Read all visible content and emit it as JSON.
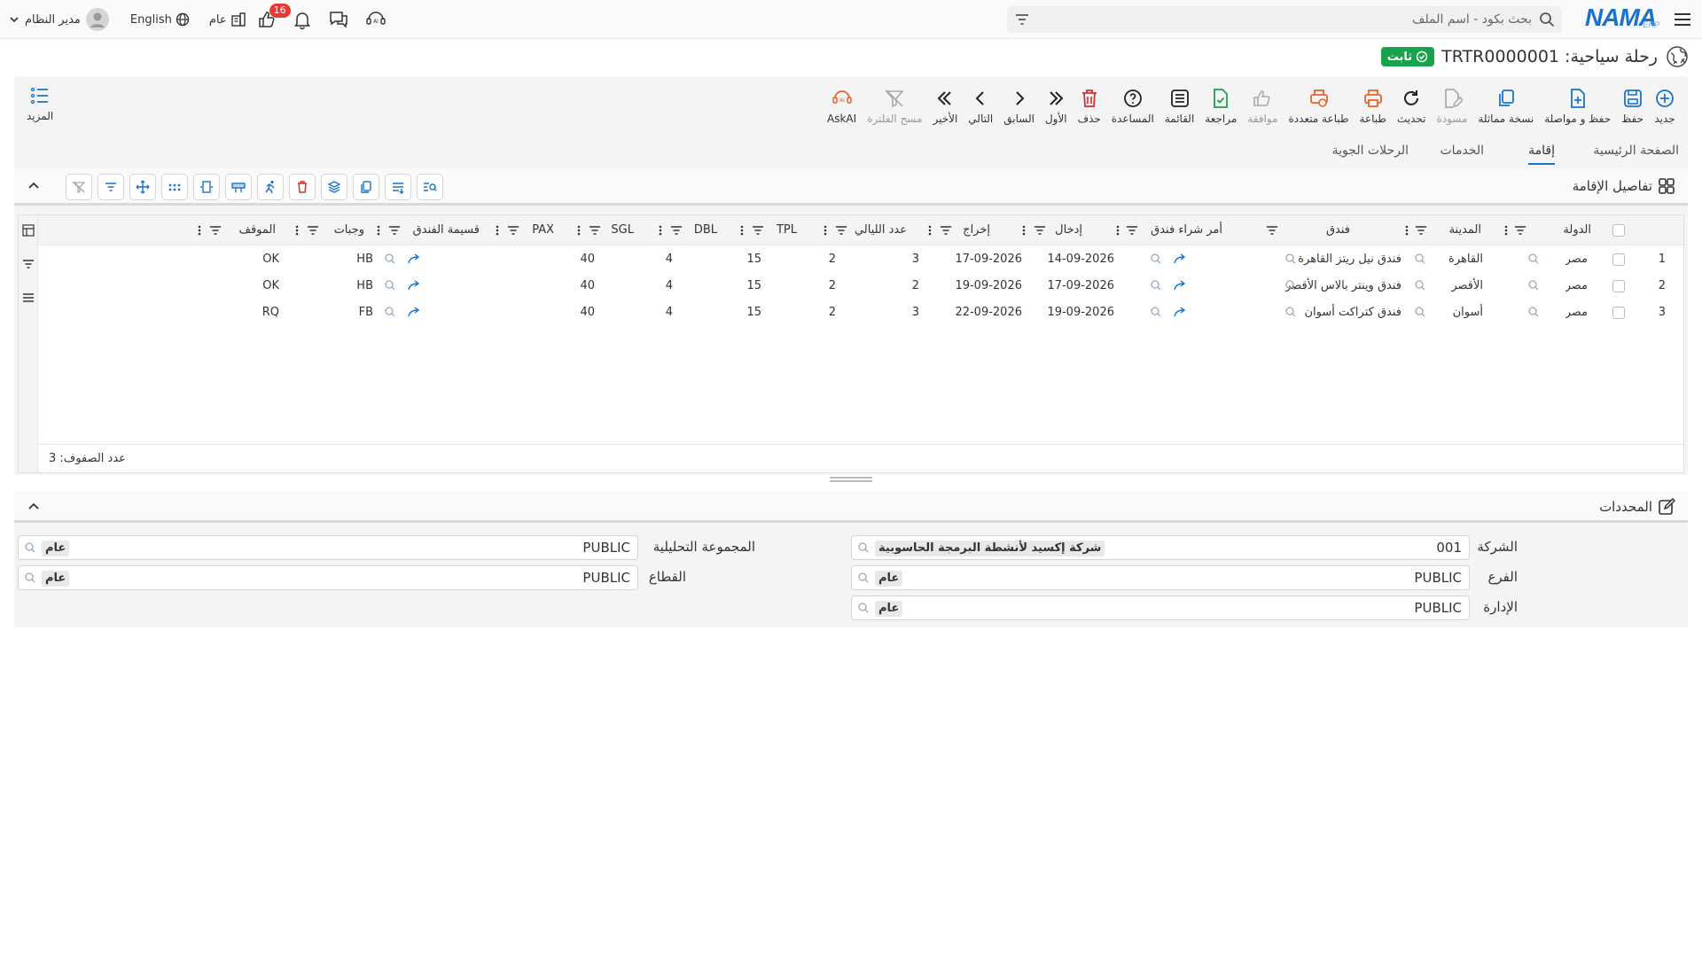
{
  "app": {
    "logo_text": "NAMA",
    "logo_sub": "ERP",
    "search_placeholder": "بحث بكود - اسم الملف",
    "user_name": "مدير النظام",
    "language": "English",
    "scope": "عام",
    "notifications_count": "16"
  },
  "page": {
    "title": "رحلة سياحية: TRTR0000001",
    "status": "ثابت"
  },
  "toolbar": {
    "items": [
      {
        "label": "جديد",
        "icon": "plus-circle-icon",
        "color": "#1a73c9"
      },
      {
        "label": "حفظ",
        "icon": "save-icon",
        "color": "#1a73c9"
      },
      {
        "label": "حفظ و مواصلة",
        "icon": "file-plus-icon",
        "color": "#1a73c9"
      },
      {
        "label": "نسخة مماثلة",
        "icon": "copy-icon",
        "color": "#1a73c9"
      },
      {
        "label": "مسودة",
        "icon": "edit-file-icon",
        "color": "#999999"
      },
      {
        "label": "تحديث",
        "icon": "refresh-icon",
        "color": "#222222"
      },
      {
        "label": "طباعة",
        "icon": "print-icon",
        "color": "#e8622c"
      },
      {
        "label": "طباعة متعددة",
        "icon": "print-multi-icon",
        "color": "#e8622c"
      },
      {
        "label": "موافقة",
        "icon": "thumbs-up-icon",
        "color": "#999999"
      },
      {
        "label": "مراجعة",
        "icon": "file-check-icon",
        "color": "#17a34a"
      },
      {
        "label": "القائمة",
        "icon": "list-icon",
        "color": "#222222"
      },
      {
        "label": "المساعدة",
        "icon": "help-icon",
        "color": "#222222"
      },
      {
        "label": "حذف",
        "icon": "trash-icon",
        "color": "#d32f2f"
      },
      {
        "label": "الأول",
        "icon": "first-icon",
        "color": "#222222"
      },
      {
        "label": "السابق",
        "icon": "prev-icon",
        "color": "#222222"
      },
      {
        "label": "التالي",
        "icon": "next-icon",
        "color": "#222222"
      },
      {
        "label": "الأخير",
        "icon": "last-icon",
        "color": "#222222"
      },
      {
        "label": "مسح الفلترة",
        "icon": "clear-filter-icon",
        "color": "#999999"
      },
      {
        "label": "AskAI",
        "icon": "ai-icon",
        "color": "#e8622c"
      }
    ],
    "more_label": "المزيد"
  },
  "tabs": [
    {
      "label": "الصفحة الرئيسية"
    },
    {
      "label": "إقامة"
    },
    {
      "label": "الخدمات"
    },
    {
      "label": "الرحلات الجوية"
    }
  ],
  "accommodation": {
    "title": "تفاصيل الإقامة",
    "columns": {
      "country": "الدولة",
      "city": "المدينة",
      "hotel": "فندق",
      "hotel_po": "أمر شراء فندق",
      "checkin": "إدخال",
      "checkout": "إخراج",
      "nights": "عدد الليالي",
      "tpl": "TPL",
      "dbl": "DBL",
      "sgl": "SGL",
      "pax": "PAX",
      "voucher": "قسيمة الفندق",
      "meals": "وجبات",
      "status": "الموقف"
    },
    "rows": [
      {
        "n": "1",
        "country": "مصر",
        "city": "القاهرة",
        "hotel": "فندق نيل ريتز القاهرة",
        "checkin": "14-09-2026",
        "checkout": "17-09-2026",
        "nights": "3",
        "tpl": "2",
        "dbl": "15",
        "sgl": "4",
        "pax": "40",
        "meals": "HB",
        "status": "OK"
      },
      {
        "n": "2",
        "country": "مصر",
        "city": "الأقصر",
        "hotel": "فندق وينتر بالاس الأقصر",
        "checkin": "17-09-2026",
        "checkout": "19-09-2026",
        "nights": "2",
        "tpl": "2",
        "dbl": "15",
        "sgl": "4",
        "pax": "40",
        "meals": "HB",
        "status": "OK"
      },
      {
        "n": "3",
        "country": "مصر",
        "city": "أسوان",
        "hotel": "فندق كتراكت أسوان",
        "checkin": "19-09-2026",
        "checkout": "22-09-2026",
        "nights": "3",
        "tpl": "2",
        "dbl": "15",
        "sgl": "4",
        "pax": "40",
        "meals": "FB",
        "status": "RQ"
      }
    ],
    "row_count": "عدد الصفوف: 3"
  },
  "dimensions": {
    "title": "المحددات",
    "company": {
      "label": "الشركة",
      "code": "001",
      "desc": "شركة إكسيد لأنشطة البرمجة الحاسوبية"
    },
    "branch": {
      "label": "الفرع",
      "code": "PUBLIC",
      "desc": "عام"
    },
    "department": {
      "label": "الإدارة",
      "code": "PUBLIC",
      "desc": "عام"
    },
    "analysis_group": {
      "label": "المجموعة التحليلية",
      "code": "PUBLIC",
      "desc": "عام"
    },
    "sector": {
      "label": "القطاع",
      "code": "PUBLIC",
      "desc": "عام"
    }
  }
}
